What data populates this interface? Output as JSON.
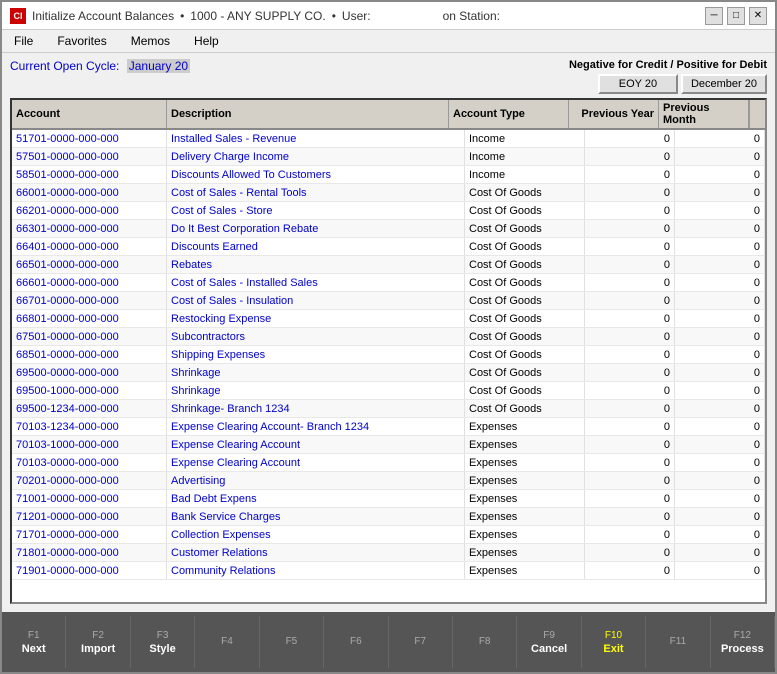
{
  "window": {
    "title": "Initialize Account Balances",
    "company": "1000 - ANY SUPPLY CO.",
    "user_label": "User:",
    "user_value": "        ",
    "station_label": "on Station:",
    "station_value": "       "
  },
  "menu": {
    "items": [
      "File",
      "Favorites",
      "Memos",
      "Help"
    ]
  },
  "cycle": {
    "label": "Current Open Cycle:",
    "value": "January 20   "
  },
  "header": {
    "negative_label": "Negative for Credit / Positive for Debit",
    "btn1": "EOY 20   ",
    "btn2": "December 20   "
  },
  "table": {
    "columns": [
      "Account",
      "Description",
      "Account Type",
      "Previous Year",
      "Previous Month"
    ],
    "rows": [
      {
        "account": "51701-0000-000-000",
        "description": "Installed Sales - Revenue",
        "type": "Income",
        "prev_year": "0",
        "prev_month": "0"
      },
      {
        "account": "57501-0000-000-000",
        "description": "Delivery Charge Income",
        "type": "Income",
        "prev_year": "0",
        "prev_month": "0"
      },
      {
        "account": "58501-0000-000-000",
        "description": "Discounts Allowed To Customers",
        "type": "Income",
        "prev_year": "0",
        "prev_month": "0"
      },
      {
        "account": "66001-0000-000-000",
        "description": "Cost of Sales - Rental Tools",
        "type": "Cost Of Goods",
        "prev_year": "0",
        "prev_month": "0"
      },
      {
        "account": "66201-0000-000-000",
        "description": "Cost of Sales - Store",
        "type": "Cost Of Goods",
        "prev_year": "0",
        "prev_month": "0"
      },
      {
        "account": "66301-0000-000-000",
        "description": "Do It Best Corporation Rebate",
        "type": "Cost Of Goods",
        "prev_year": "0",
        "prev_month": "0"
      },
      {
        "account": "66401-0000-000-000",
        "description": "Discounts Earned",
        "type": "Cost Of Goods",
        "prev_year": "0",
        "prev_month": "0"
      },
      {
        "account": "66501-0000-000-000",
        "description": "Rebates",
        "type": "Cost Of Goods",
        "prev_year": "0",
        "prev_month": "0"
      },
      {
        "account": "66601-0000-000-000",
        "description": "Cost of Sales - Installed Sales",
        "type": "Cost Of Goods",
        "prev_year": "0",
        "prev_month": "0"
      },
      {
        "account": "66701-0000-000-000",
        "description": "Cost of Sales - Insulation",
        "type": "Cost Of Goods",
        "prev_year": "0",
        "prev_month": "0"
      },
      {
        "account": "66801-0000-000-000",
        "description": "Restocking Expense",
        "type": "Cost Of Goods",
        "prev_year": "0",
        "prev_month": "0"
      },
      {
        "account": "67501-0000-000-000",
        "description": "Subcontractors",
        "type": "Cost Of Goods",
        "prev_year": "0",
        "prev_month": "0"
      },
      {
        "account": "68501-0000-000-000",
        "description": "Shipping Expenses",
        "type": "Cost Of Goods",
        "prev_year": "0",
        "prev_month": "0"
      },
      {
        "account": "69500-0000-000-000",
        "description": "Shrinkage",
        "type": "Cost Of Goods",
        "prev_year": "0",
        "prev_month": "0"
      },
      {
        "account": "69500-1000-000-000",
        "description": "Shrinkage",
        "type": "Cost Of Goods",
        "prev_year": "0",
        "prev_month": "0"
      },
      {
        "account": "69500-1234-000-000",
        "description": "Shrinkage- Branch 1234",
        "type": "Cost Of Goods",
        "prev_year": "0",
        "prev_month": "0"
      },
      {
        "account": "70103-1234-000-000",
        "description": "Expense Clearing Account- Branch 1234",
        "type": "Expenses",
        "prev_year": "0",
        "prev_month": "0"
      },
      {
        "account": "70103-1000-000-000",
        "description": "Expense Clearing Account",
        "type": "Expenses",
        "prev_year": "0",
        "prev_month": "0"
      },
      {
        "account": "70103-0000-000-000",
        "description": "Expense Clearing Account",
        "type": "Expenses",
        "prev_year": "0",
        "prev_month": "0"
      },
      {
        "account": "70201-0000-000-000",
        "description": "Advertising",
        "type": "Expenses",
        "prev_year": "0",
        "prev_month": "0"
      },
      {
        "account": "71001-0000-000-000",
        "description": "Bad Debt Expens",
        "type": "Expenses",
        "prev_year": "0",
        "prev_month": "0"
      },
      {
        "account": "71201-0000-000-000",
        "description": "Bank Service Charges",
        "type": "Expenses",
        "prev_year": "0",
        "prev_month": "0"
      },
      {
        "account": "71701-0000-000-000",
        "description": "Collection Expenses",
        "type": "Expenses",
        "prev_year": "0",
        "prev_month": "0"
      },
      {
        "account": "71801-0000-000-000",
        "description": "Customer Relations",
        "type": "Expenses",
        "prev_year": "0",
        "prev_month": "0"
      },
      {
        "account": "71901-0000-000-000",
        "description": "Community Relations",
        "type": "Expenses",
        "prev_year": "0",
        "prev_month": "0"
      }
    ]
  },
  "footer": {
    "keys": [
      {
        "fn": "F1",
        "label": "Next"
      },
      {
        "fn": "F2",
        "label": "Import"
      },
      {
        "fn": "F3",
        "label": "Style"
      },
      {
        "fn": "F4",
        "label": ""
      },
      {
        "fn": "F5",
        "label": ""
      },
      {
        "fn": "F6",
        "label": ""
      },
      {
        "fn": "F7",
        "label": ""
      },
      {
        "fn": "F8",
        "label": ""
      },
      {
        "fn": "F9",
        "label": "Cancel"
      },
      {
        "fn": "F10",
        "label": "Exit",
        "highlighted": true
      },
      {
        "fn": "F11",
        "label": ""
      },
      {
        "fn": "F12",
        "label": "Process"
      }
    ]
  }
}
